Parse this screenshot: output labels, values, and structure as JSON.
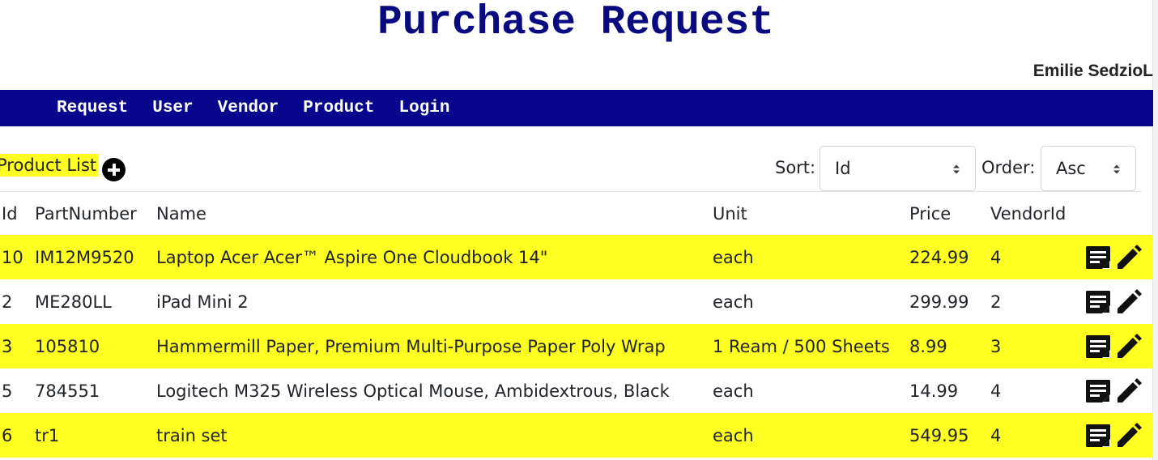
{
  "page": {
    "title": "Purchase Request",
    "user_name": "Emilie SedzioL"
  },
  "nav": {
    "items": [
      {
        "label": "Request"
      },
      {
        "label": "User"
      },
      {
        "label": "Vendor"
      },
      {
        "label": "Product"
      },
      {
        "label": "Login"
      }
    ]
  },
  "list": {
    "title": "Product List",
    "sort_label": "Sort:",
    "sort_value": "Id",
    "order_label": "Order:",
    "order_value": "Asc"
  },
  "table": {
    "columns": [
      "Id",
      "PartNumber",
      "Name",
      "Unit",
      "Price",
      "VendorId"
    ],
    "rows": [
      {
        "id": "10",
        "part": "IM12M9520",
        "name": "Laptop Acer Acer™ Aspire One Cloudbook 14\"",
        "unit": "each",
        "price": "224.99",
        "vendor": "4"
      },
      {
        "id": "2",
        "part": "ME280LL",
        "name": "iPad Mini 2",
        "unit": "each",
        "price": "299.99",
        "vendor": "2"
      },
      {
        "id": "3",
        "part": "105810",
        "name": "Hammermill Paper, Premium Multi-Purpose Paper Poly Wrap",
        "unit": "1 Ream / 500 Sheets",
        "price": "8.99",
        "vendor": "3"
      },
      {
        "id": "5",
        "part": "784551",
        "name": "Logitech M325 Wireless Optical Mouse, Ambidextrous, Black",
        "unit": "each",
        "price": "14.99",
        "vendor": "4"
      },
      {
        "id": "6",
        "part": "tr1",
        "name": "train set",
        "unit": "each",
        "price": "549.95",
        "vendor": "4"
      }
    ]
  },
  "colors": {
    "nav_bg": "#07068c",
    "title": "#0a0a80",
    "highlight": "#ffff22"
  },
  "icons": {
    "add": "add-circle-icon",
    "detail": "notes-icon",
    "edit": "pencil-icon",
    "caret": "sort-caret-icon"
  }
}
